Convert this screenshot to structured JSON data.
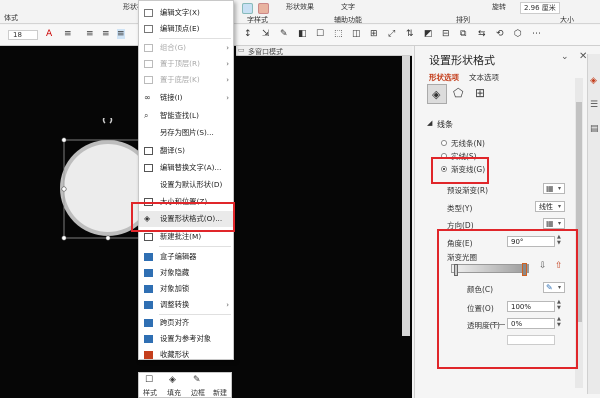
{
  "ribbon": {
    "shape_style_label": "形状样式",
    "shape_effects_label": "形状效果",
    "text_label": "文字",
    "aux_label": "辅助功能",
    "arrange_label": "排列",
    "size_label": "大小",
    "rotate_label": "旋转",
    "height_value": "2.96 厘米",
    "font_size": "18",
    "wordart_label": "字样式",
    "multi_window_label": "多窗口模式"
  },
  "context_menu": {
    "items": [
      {
        "label": "编辑文字(X)",
        "enabled": true,
        "submenu": false
      },
      {
        "label": "编辑顶点(E)",
        "enabled": true,
        "submenu": false
      },
      {
        "label": "组合(G)",
        "enabled": false,
        "submenu": true
      },
      {
        "label": "置于顶层(R)",
        "enabled": false,
        "submenu": true
      },
      {
        "label": "置于底层(K)",
        "enabled": false,
        "submenu": true
      },
      {
        "label": "链接(I)",
        "enabled": true,
        "submenu": true
      },
      {
        "label": "智能查找(L)",
        "enabled": true,
        "submenu": false
      },
      {
        "label": "另存为图片(S)...",
        "enabled": true,
        "submenu": false
      },
      {
        "label": "翻译(S)",
        "enabled": true,
        "submenu": false
      },
      {
        "label": "编辑替换文字(A)...",
        "enabled": true,
        "submenu": false
      },
      {
        "label": "设置为默认形状(D)",
        "enabled": true,
        "submenu": false
      },
      {
        "label": "大小和位置(Z)...",
        "enabled": true,
        "submenu": false
      },
      {
        "label": "设置形状格式(O)...",
        "enabled": true,
        "submenu": false
      },
      {
        "label": "新建批注(M)",
        "enabled": true,
        "submenu": false
      },
      {
        "label": "盒子编辑器",
        "enabled": true,
        "submenu": false
      },
      {
        "label": "对象隐藏",
        "enabled": true,
        "submenu": false
      },
      {
        "label": "对象加锁",
        "enabled": true,
        "submenu": false
      },
      {
        "label": "调整转换",
        "enabled": true,
        "submenu": true
      },
      {
        "label": "跨页对齐",
        "enabled": true,
        "submenu": false
      },
      {
        "label": "设置为参考对象",
        "enabled": true,
        "submenu": false
      },
      {
        "label": "收藏形状",
        "enabled": true,
        "submenu": false
      }
    ]
  },
  "mini_toolbar": {
    "style_label": "样式",
    "fill_label": "填充",
    "outline_label": "边框",
    "new_comment_label": "新建"
  },
  "pane": {
    "title": "设置形状格式",
    "tab_shape": "形状选项",
    "tab_text": "文本选项",
    "section_line": "线条",
    "radio_no_line": "无线条(N)",
    "radio_solid": "实线(S)",
    "radio_gradient": "渐变线(G)",
    "selected_radio": "gradient",
    "preset_gradient_label": "预设渐变(R)",
    "type_label": "类型(Y)",
    "type_value": "线性",
    "direction_label": "方向(D)",
    "angle_label": "角度(E)",
    "angle_value": "90°",
    "stops_label": "渐变光圈",
    "color_label": "颜色(C)",
    "position_label": "位置(O)",
    "position_value": "100%",
    "transparency_label": "透明度(T)",
    "transparency_value": "0%"
  },
  "colors": {
    "highlight_red": "#e0262a",
    "accent": "#c43e1c"
  }
}
